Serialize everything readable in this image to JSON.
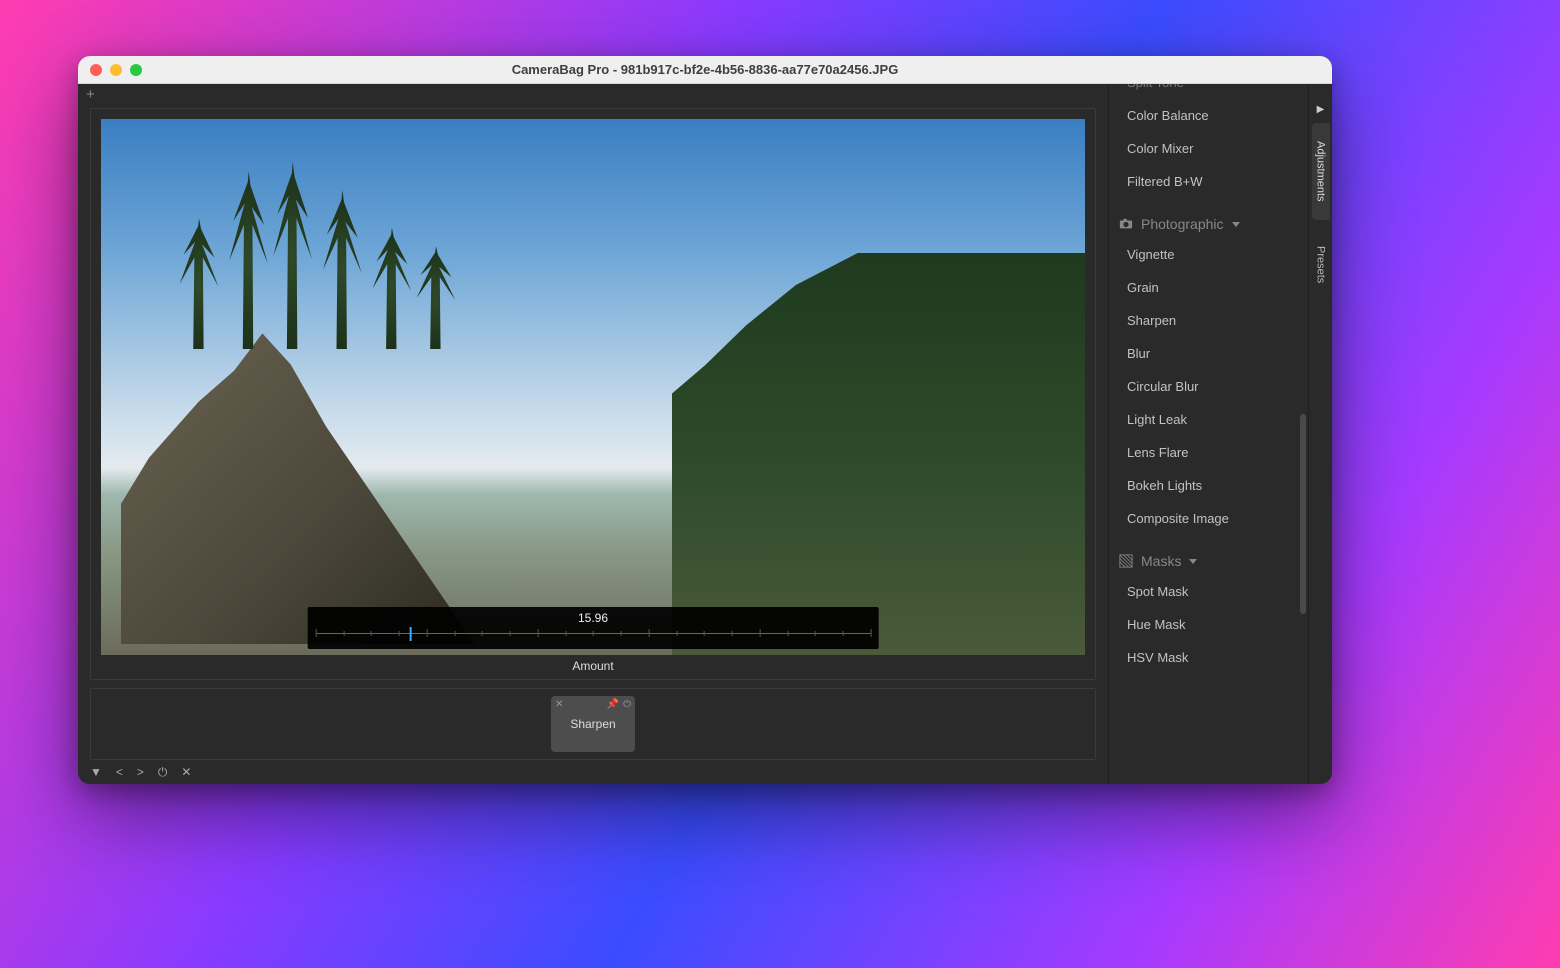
{
  "window": {
    "title": "CameraBag Pro - 981b917c-bf2e-4b56-8836-aa77e70a2456.JPG"
  },
  "slider": {
    "value": "15.96",
    "label": "Amount",
    "handle_pct": 17
  },
  "active_tile": {
    "label": "Sharpen"
  },
  "side_tabs": {
    "adjustments": "Adjustments",
    "presets": "Presets"
  },
  "adjustments": {
    "clipped_top": "Split Tone",
    "color_items": [
      "Color Balance",
      "Color Mixer",
      "Filtered B+W"
    ],
    "group_photo": "Photographic",
    "photo_items": [
      "Vignette",
      "Grain",
      "Sharpen",
      "Blur",
      "Circular Blur",
      "Light Leak",
      "Lens Flare",
      "Bokeh Lights",
      "Composite Image"
    ],
    "group_masks": "Masks",
    "mask_items": [
      "Spot Mask",
      "Hue Mask",
      "HSV Mask"
    ]
  }
}
